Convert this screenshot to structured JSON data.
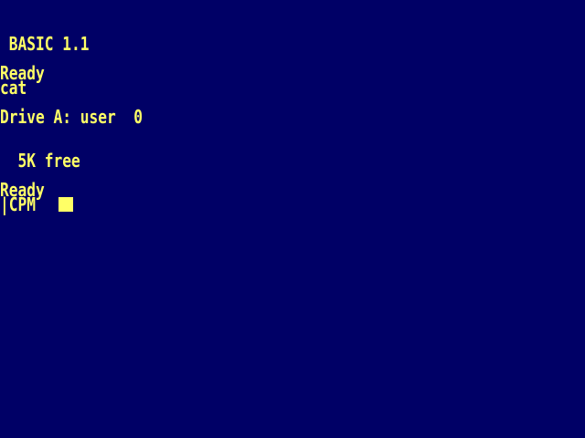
{
  "colors": {
    "background": "#000066",
    "text": "#ffff66"
  },
  "terminal": {
    "lines": [
      " BASIC 1.1",
      "Ready",
      "cat",
      "Drive A: user  0",
      "  5K free",
      "Ready",
      "|CPM"
    ],
    "cursor": "block"
  }
}
